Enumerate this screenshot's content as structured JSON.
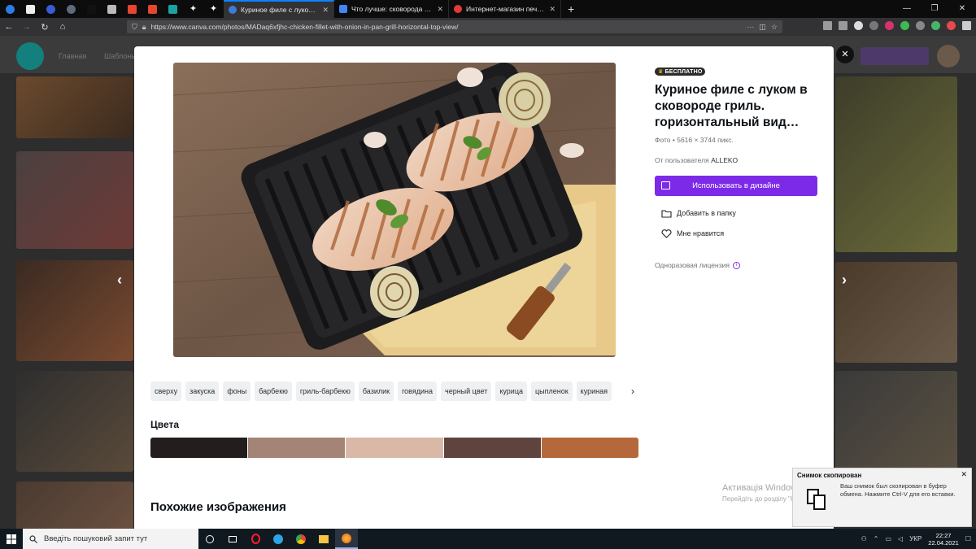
{
  "browser": {
    "tabs": [
      {
        "label": "Куриное филе с луком в сков",
        "active": true,
        "icon_color": "#3d7bd9"
      },
      {
        "label": "Что лучше: сковорода гриль",
        "active": false,
        "icon_color": "#4285f4"
      },
      {
        "label": "Интернет-магазин печей и ка",
        "active": false,
        "icon_color": "#e53935"
      }
    ],
    "url": "https://www.canva.com/photos/MADaq6xfjhc-chicken-fillet-with-onion-in-pan-grill-horizontal-top-view/"
  },
  "background_nav": [
    "Главная",
    "Шаблоны"
  ],
  "modal": {
    "badge": "БЕСПЛАТНО",
    "title": "Куриное филе с луком в сковороде гриль. горизонтальный вид…",
    "meta": "Фото • 5616 × 3744 пикс.",
    "author_prefix": "От пользователя",
    "author": "ALLEKO",
    "use_button": "Использовать в дизайне",
    "add_to_folder": "Добавить в папку",
    "like": "Мне нравится",
    "license": "Одноразовая лицензия",
    "tags": [
      "сверху",
      "закуска",
      "фоны",
      "барбекю",
      "гриль-барбекю",
      "базилик",
      "говядина",
      "черный цвет",
      "курица",
      "цыпленок",
      "куриная"
    ],
    "colors_heading": "Цвета",
    "colors": [
      "#231d1d",
      "#a38476",
      "#d9b8a8",
      "#5e443d",
      "#b5683b"
    ],
    "similar_heading": "Похожие изображения"
  },
  "watermark": {
    "line1": "Активація Windows",
    "line2": "Перейдіть до розділу \"Настройки\", щоб активувати Windows."
  },
  "toast": {
    "title": "Снимок скопирован",
    "body": "Ваш снимок был скопирован в буфер обмена. Нажмите Ctrl-V для его вставки."
  },
  "taskbar": {
    "search_placeholder": "Введіть пошуковий запит тут",
    "lang": "УКР",
    "time": "22:27",
    "date": "22.04.2021"
  }
}
